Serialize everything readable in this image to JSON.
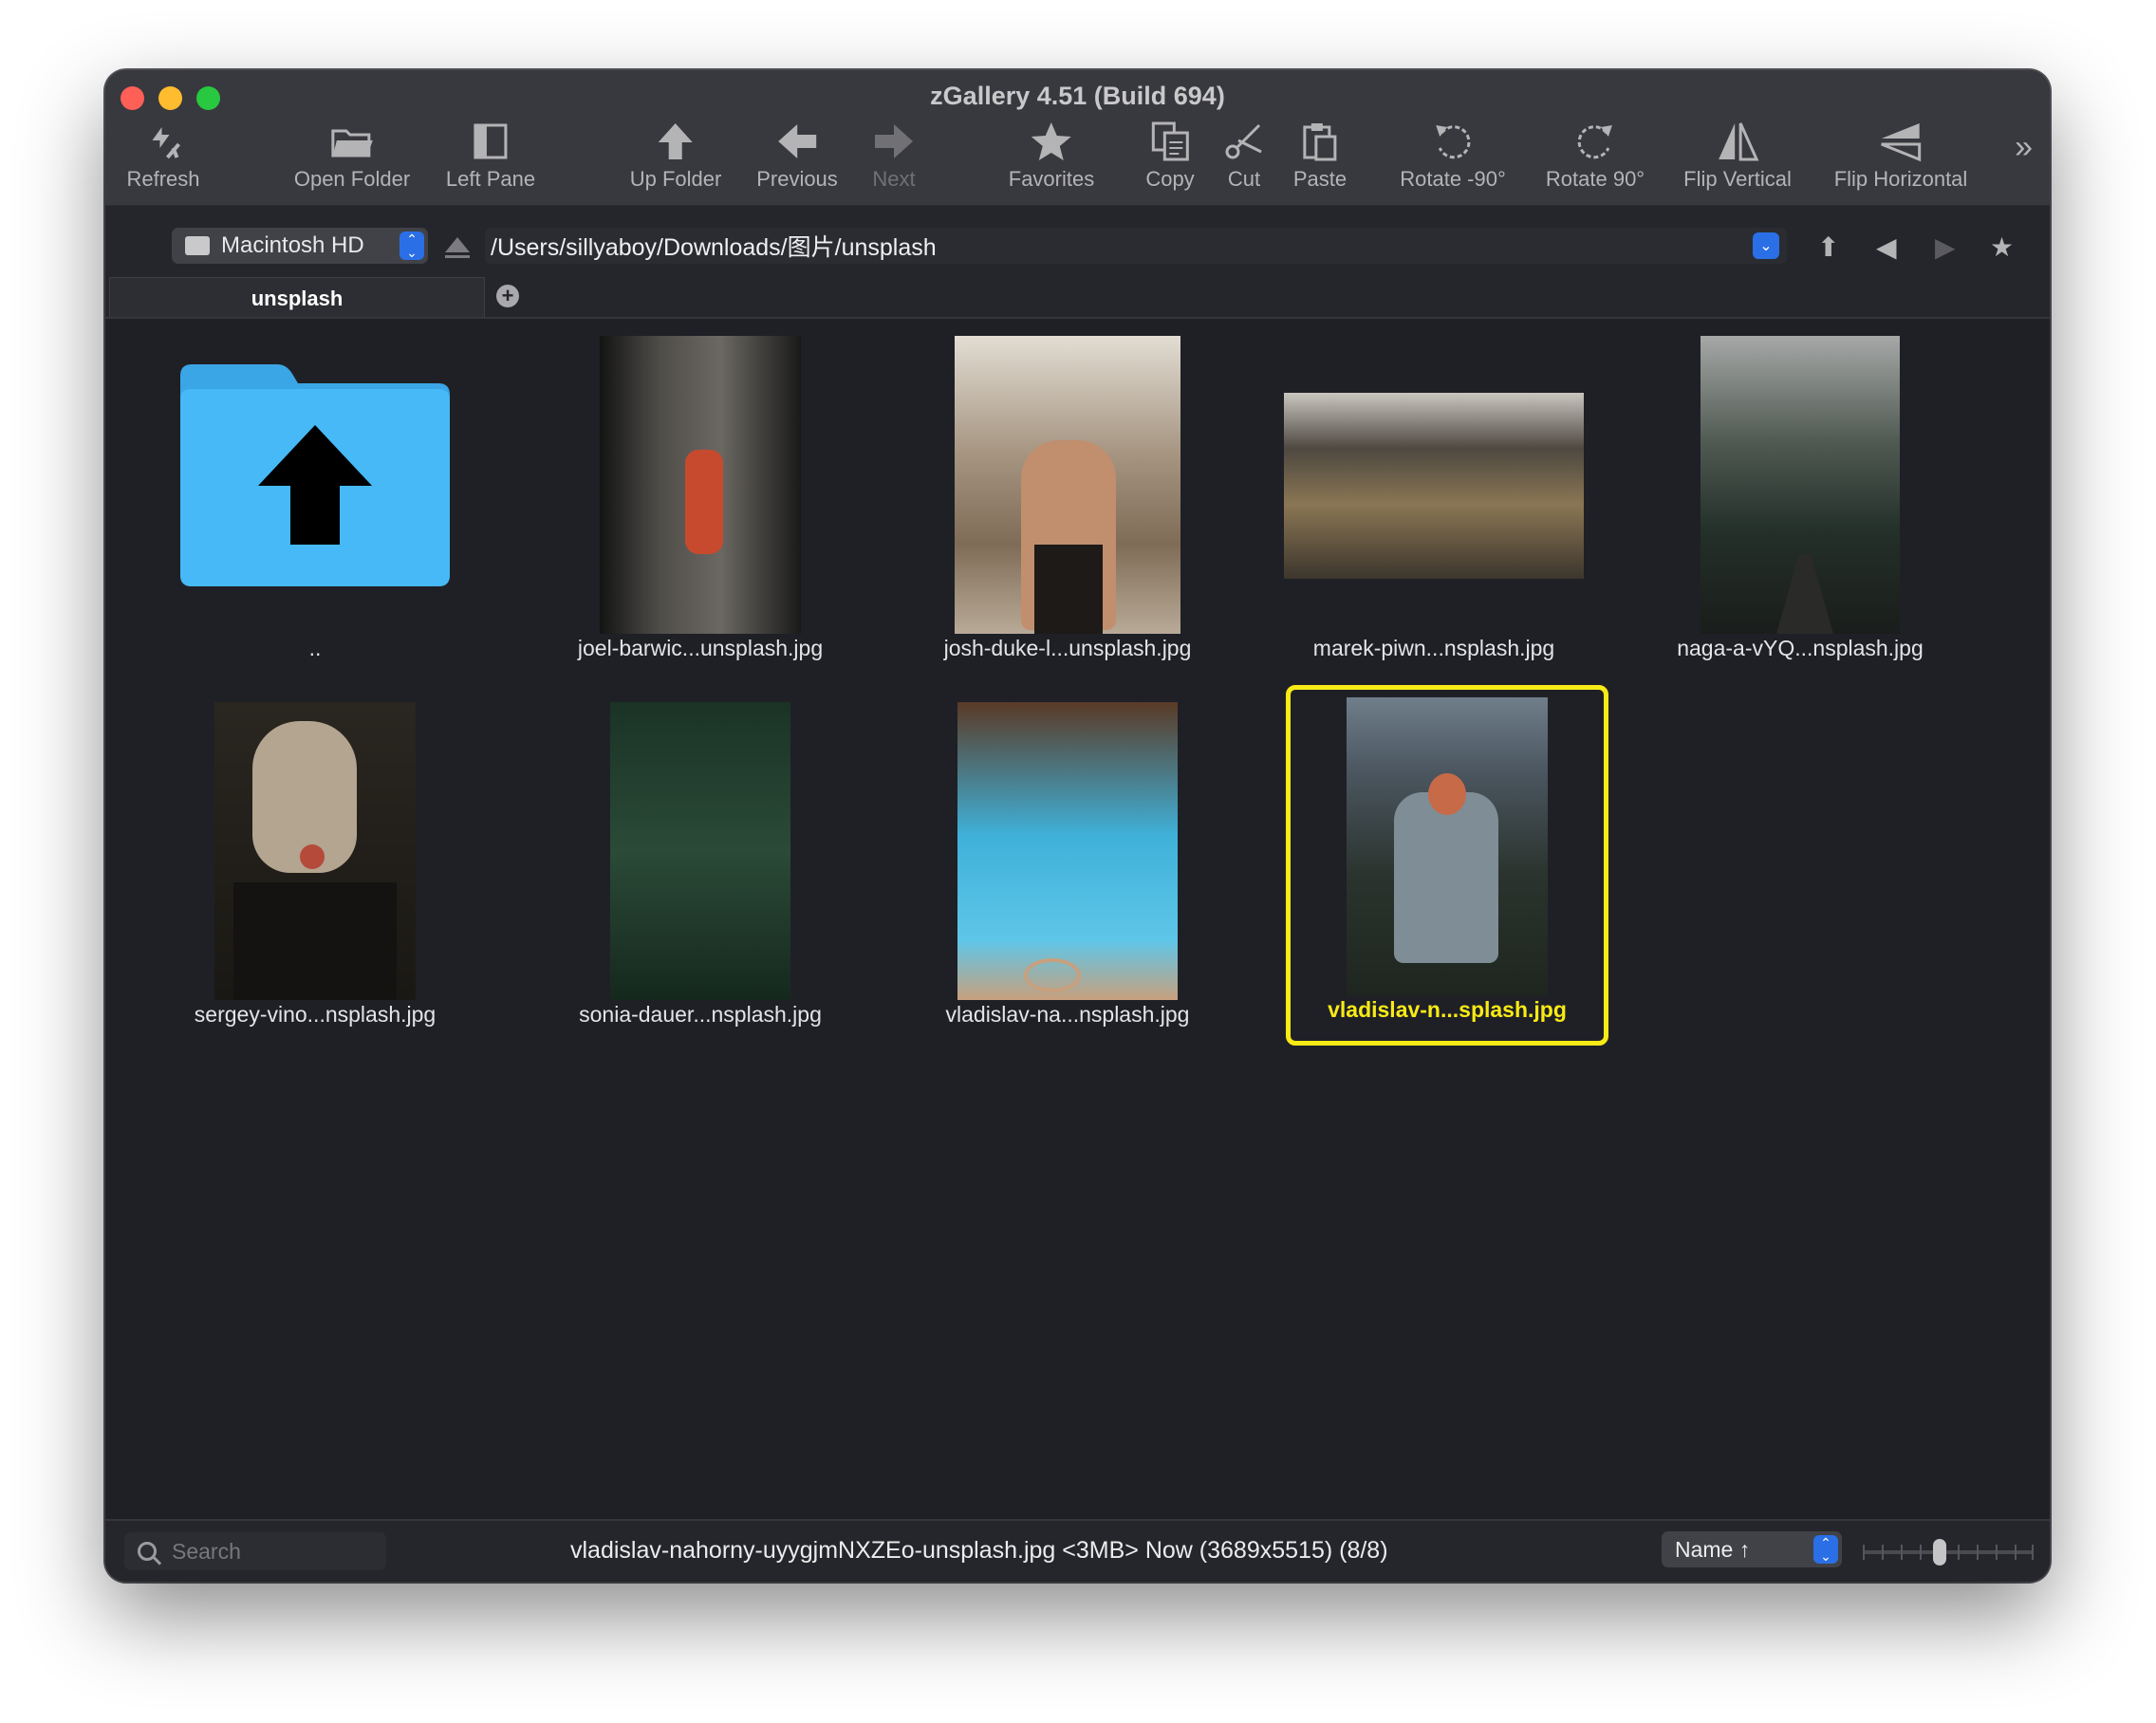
{
  "window": {
    "title": "zGallery 4.51 (Build 694)"
  },
  "toolbar": {
    "items": [
      {
        "label": "Refresh",
        "icon": "refresh-icon",
        "enabled": true
      },
      {
        "label": "Open Folder",
        "icon": "folder-open-icon",
        "enabled": true
      },
      {
        "label": "Left Pane",
        "icon": "sidebar-icon",
        "enabled": true
      },
      {
        "label": "Up Folder",
        "icon": "arrow-up-icon",
        "enabled": true
      },
      {
        "label": "Previous",
        "icon": "arrow-left-icon",
        "enabled": true
      },
      {
        "label": "Next",
        "icon": "arrow-right-icon",
        "enabled": false
      },
      {
        "label": "Favorites",
        "icon": "star-icon",
        "enabled": true
      },
      {
        "label": "Copy",
        "icon": "copy-icon",
        "enabled": true
      },
      {
        "label": "Cut",
        "icon": "scissors-icon",
        "enabled": true
      },
      {
        "label": "Paste",
        "icon": "clipboard-icon",
        "enabled": true
      },
      {
        "label": "Rotate -90°",
        "icon": "rotate-left-icon",
        "enabled": true
      },
      {
        "label": "Rotate 90°",
        "icon": "rotate-right-icon",
        "enabled": true
      },
      {
        "label": "Flip Vertical",
        "icon": "flip-vertical-icon",
        "enabled": true
      },
      {
        "label": "Flip Horizontal",
        "icon": "flip-horizontal-icon",
        "enabled": true
      }
    ],
    "more": "»"
  },
  "pathbar": {
    "volume": "Macintosh HD",
    "path": "/Users/sillyaboy/Downloads/图片/unsplash"
  },
  "tabs": [
    {
      "label": "unsplash",
      "active": true
    }
  ],
  "grid": {
    "items": [
      {
        "caption": "..",
        "type": "parent-folder"
      },
      {
        "caption": "joel-barwic...unsplash.jpg",
        "type": "image",
        "colors": [
          "#1b1b1c",
          "#5e5b55",
          "#c84a2e"
        ]
      },
      {
        "caption": "josh-duke-l...unsplash.jpg",
        "type": "image",
        "colors": [
          "#d9d3c8",
          "#8f7a64",
          "#2a221d"
        ]
      },
      {
        "caption": "marek-piwn...nsplash.jpg",
        "type": "image",
        "colors": [
          "#5c554c",
          "#8b7a5b",
          "#3b352d"
        ]
      },
      {
        "caption": "naga-a-vYQ...nsplash.jpg",
        "type": "image",
        "colors": [
          "#9ea09f",
          "#2f3a32",
          "#1c211e"
        ]
      },
      {
        "caption": "sergey-vino...nsplash.jpg",
        "type": "image",
        "colors": [
          "#1d1a16",
          "#b9aa95",
          "#2b2a21"
        ]
      },
      {
        "caption": "sonia-dauer...nsplash.jpg",
        "type": "image",
        "colors": [
          "#1f3a2b",
          "#2e4a36",
          "#17291f"
        ]
      },
      {
        "caption": "vladislav-na...nsplash.jpg",
        "type": "image",
        "colors": [
          "#3db3dc",
          "#c9a28c",
          "#6e4226"
        ]
      },
      {
        "caption": "vladislav-n...splash.jpg",
        "type": "image",
        "selected": true,
        "colors": [
          "#6b7a86",
          "#26302a",
          "#c76a48"
        ]
      }
    ]
  },
  "status": {
    "search_placeholder": "Search",
    "text": "vladislav-nahorny-uyygjmNXZEo-unsplash.jpg <3MB> Now (3689x5515) (8/8)",
    "sort": "Name ↑",
    "zoom_level": 0.45
  },
  "colors": {
    "selection": "#f8ea16",
    "accent": "#2b6fe6",
    "folder": "#43b6f5"
  }
}
